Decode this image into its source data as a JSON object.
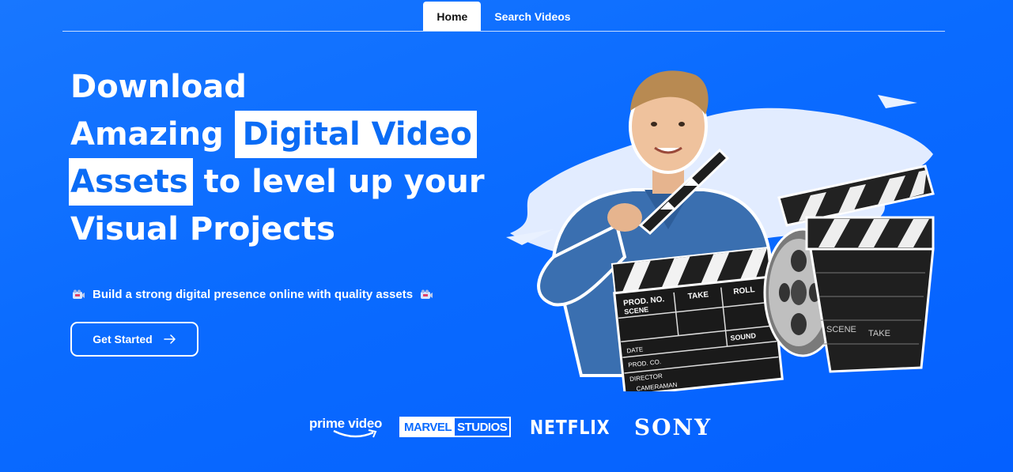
{
  "nav": {
    "tabs": [
      {
        "label": "Home",
        "active": true
      },
      {
        "label": "Search Videos",
        "active": false
      }
    ]
  },
  "hero": {
    "headline": {
      "line1": "Download",
      "line2_plain": "Amazing ",
      "line2_highlight": "Digital Video",
      "line3_highlight": "Assets",
      "line3_plain": " to level up your",
      "line4": "Visual Projects"
    },
    "tagline": "Build a strong digital presence online with quality assets",
    "tagline_icon": "video-camera-icon",
    "cta_label": "Get Started",
    "cta_icon": "arrow-right-icon",
    "clapper_text": {
      "prod_no": "PROD. NO.",
      "scene": "SCENE",
      "take": "TAKE",
      "roll": "ROLL",
      "date": "DATE",
      "sound": "SOUND",
      "prod_co": "PROD. CO.",
      "director": "DIRECTOR",
      "cameraman": "CAMERAMAN",
      "back_scene": "SCENE",
      "back_take": "TAKE"
    }
  },
  "partners": {
    "prime": "prime video",
    "marvel_a": "MARVEL",
    "marvel_b": "STUDIOS",
    "netflix": "NETFLIX",
    "sony": "SONY"
  },
  "colors": {
    "background": "#0a6bff",
    "highlight_text": "#0b6cf5",
    "white": "#ffffff"
  }
}
